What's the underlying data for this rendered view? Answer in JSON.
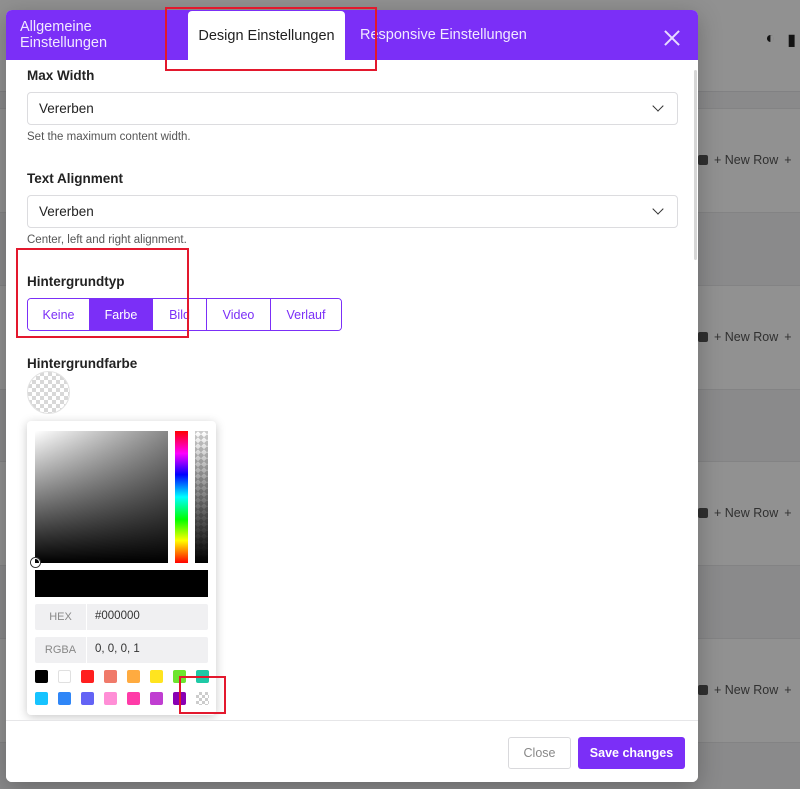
{
  "tabs": [
    {
      "label": "Allgemeine Einstellungen"
    },
    {
      "label": "Design Einstellungen"
    },
    {
      "label": "Responsive Einstellungen"
    }
  ],
  "background_rows": {
    "new_row_label": "+ New Row",
    "plus": "+"
  },
  "fields": {
    "max_width": {
      "label": "Max Width",
      "value": "Vererben",
      "help": "Set the maximum content width."
    },
    "text_alignment": {
      "label": "Text Alignment",
      "value": "Vererben",
      "help": "Center, left and right alignment."
    },
    "background_type": {
      "label": "Hintergrundtyp",
      "options": [
        "Keine",
        "Farbe",
        "Bild",
        "Video",
        "Verlauf"
      ],
      "selected": "Farbe"
    },
    "background_color": {
      "label": "Hintergrundfarbe"
    }
  },
  "color_picker": {
    "hex_label": "HEX",
    "hex_value": "#000000",
    "rgba_label": "RGBA",
    "rgba_value": "0, 0, 0, 1",
    "preview_color": "#000000",
    "swatches": [
      "#000000",
      "#ffffff",
      "#ff1f1f",
      "#f07a6a",
      "#ffab40",
      "#ffe41f",
      "#6ee52d",
      "#1fc9a6",
      "#16c3ff",
      "#2f86f7",
      "#6363f5",
      "#ff8ed6",
      "#ff3ba8",
      "#c03ed1",
      "#8a00b3",
      "transparent"
    ]
  },
  "footer": {
    "close_label": "Close",
    "save_label": "Save changes"
  },
  "colors": {
    "accent": "#7b2ff7",
    "annotation": "#e3182d"
  }
}
